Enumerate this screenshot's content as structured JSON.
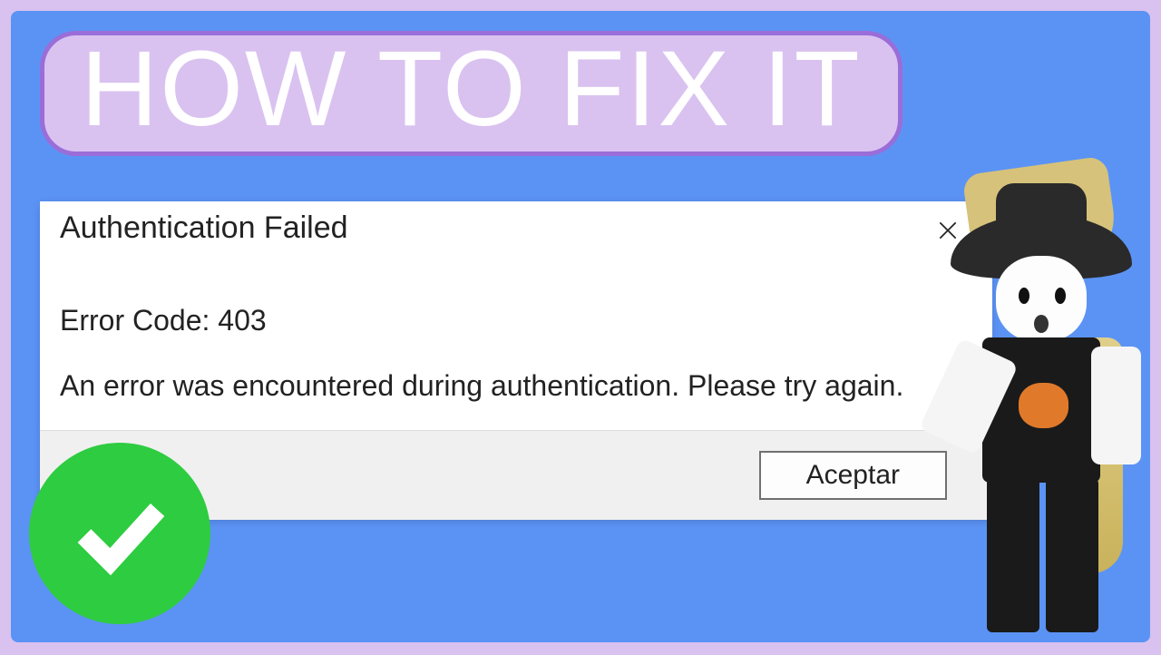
{
  "banner": {
    "title": "HOW TO FIX IT"
  },
  "dialog": {
    "title": "Authentication Failed",
    "error_code_line": "Error Code: 403",
    "message": "An error was encountered during authentication. Please try again.",
    "accept_label": "Aceptar"
  },
  "icons": {
    "close": "close-icon",
    "checkmark": "checkmark-icon"
  },
  "colors": {
    "outer_bg": "#d9c2f0",
    "inner_bg": "#5b93f5",
    "badge_border": "#9a6dd8",
    "checkmark_bg": "#2ecc40"
  }
}
